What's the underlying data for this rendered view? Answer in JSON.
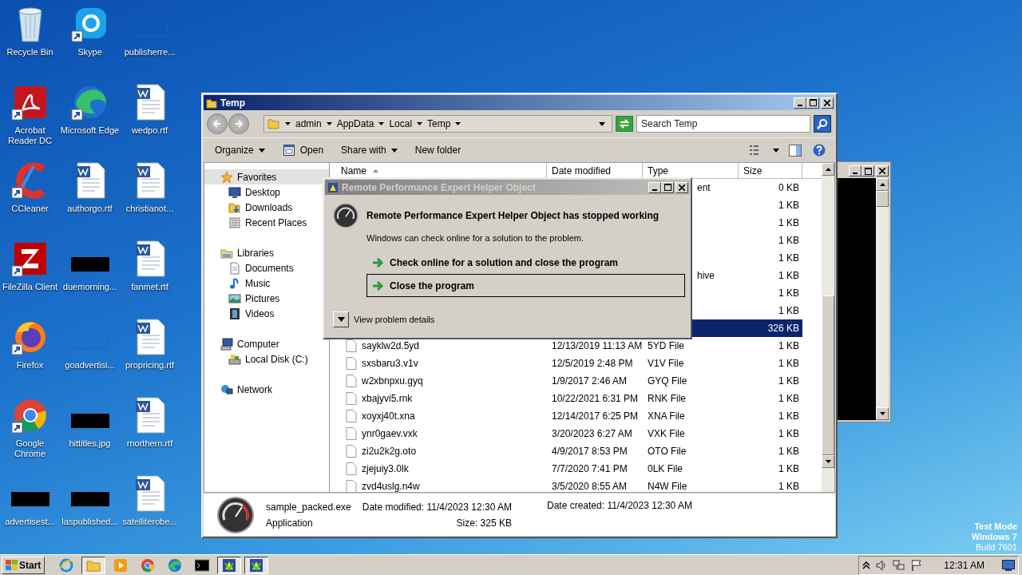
{
  "desktop_icons": [
    {
      "label": "Recycle Bin",
      "kind": "recycle-bin",
      "shortcut": false
    },
    {
      "label": "Acrobat Reader DC",
      "kind": "acrobat",
      "shortcut": true
    },
    {
      "label": "CCleaner",
      "kind": "ccleaner",
      "shortcut": true
    },
    {
      "label": "FileZilla Client",
      "kind": "filezilla",
      "shortcut": true
    },
    {
      "label": "Firefox",
      "kind": "firefox",
      "shortcut": true
    },
    {
      "label": "Google Chrome",
      "kind": "chrome",
      "shortcut": true
    },
    {
      "label": "advertisest...",
      "kind": "redacted",
      "shortcut": false
    },
    {
      "label": "Skype",
      "kind": "skype",
      "shortcut": true
    },
    {
      "label": "Microsoft Edge",
      "kind": "edge",
      "shortcut": true
    },
    {
      "label": "authorgo.rtf",
      "kind": "document",
      "shortcut": false
    },
    {
      "label": "duemorning...",
      "kind": "redacted",
      "shortcut": false
    },
    {
      "label": "goadvertisi...",
      "kind": "blank",
      "shortcut": false
    },
    {
      "label": "hittitles.jpg",
      "kind": "redacted",
      "shortcut": false
    },
    {
      "label": "laspublished...",
      "kind": "redacted",
      "shortcut": false
    },
    {
      "label": "publisherre...",
      "kind": "blank",
      "shortcut": false
    },
    {
      "label": "wedpo.rtf",
      "kind": "document",
      "shortcut": false
    },
    {
      "label": "christianot...",
      "kind": "document",
      "shortcut": false
    },
    {
      "label": "fanmet.rtf",
      "kind": "document",
      "shortcut": false
    },
    {
      "label": "propricing.rtf",
      "kind": "document",
      "shortcut": false
    },
    {
      "label": "rnorthern.rtf",
      "kind": "document",
      "shortcut": false
    },
    {
      "label": "satelliterobe...",
      "kind": "document",
      "shortcut": false
    }
  ],
  "explorer": {
    "title": "Temp",
    "breadcrumb": [
      "admin",
      "AppData",
      "Local",
      "Temp"
    ],
    "search": {
      "placeholder": "Search Temp"
    },
    "toolbar": [
      {
        "label": "Organize",
        "kind": "menu"
      },
      {
        "label": "Open",
        "kind": "open"
      },
      {
        "label": "Share with",
        "kind": "menu"
      },
      {
        "label": "New folder",
        "kind": "plain"
      }
    ],
    "nav": [
      {
        "label": "Favorites",
        "kind": "star",
        "selected": true,
        "children": [
          {
            "label": "Desktop",
            "kind": "desktop",
            "selected": false
          },
          {
            "label": "Downloads",
            "kind": "downloads",
            "selected": false
          },
          {
            "label": "Recent Places",
            "kind": "recent",
            "selected": false
          }
        ]
      },
      {
        "label": "Libraries",
        "kind": "library",
        "selected": false,
        "children": [
          {
            "label": "Documents",
            "kind": "documents",
            "selected": false
          },
          {
            "label": "Music",
            "kind": "music",
            "selected": false
          },
          {
            "label": "Pictures",
            "kind": "pictures",
            "selected": false
          },
          {
            "label": "Videos",
            "kind": "videos",
            "selected": false
          }
        ]
      },
      {
        "label": "Computer",
        "kind": "computer",
        "selected": false,
        "children": [
          {
            "label": "Local Disk (C:)",
            "kind": "disk",
            "selected": false
          }
        ]
      },
      {
        "label": "Network",
        "kind": "network",
        "selected": false
      }
    ],
    "columns": [
      "Name",
      "Date modified",
      "Type",
      "Size"
    ],
    "rows": [
      {
        "type_partial": "ent",
        "size": "0 KB",
        "selected": false
      },
      {
        "size": "1 KB",
        "selected": false
      },
      {
        "size": "1 KB",
        "selected": false
      },
      {
        "size": "1 KB",
        "selected": false
      },
      {
        "size": "1 KB",
        "selected": false
      },
      {
        "type_partial": "hive",
        "size": "1 KB",
        "selected": false
      },
      {
        "size": "1 KB",
        "selected": false
      },
      {
        "size": "1 KB",
        "selected": false
      },
      {
        "size": "326 KB",
        "selected": true
      },
      {
        "name": "sayklw2d.5yd",
        "date": "12/13/2019 11:13 AM",
        "type": "5YD File",
        "size": "1 KB",
        "selected": false
      },
      {
        "name": "sxsbaru3.v1v",
        "date": "12/5/2019 2:48 PM",
        "type": "V1V File",
        "size": "1 KB",
        "selected": false
      },
      {
        "name": "w2xbnpxu.gyq",
        "date": "1/9/2017 2:46 AM",
        "type": "GYQ File",
        "size": "1 KB",
        "selected": false
      },
      {
        "name": "xbajyvi5.rnk",
        "date": "10/22/2021 6:31 PM",
        "type": "RNK File",
        "size": "1 KB",
        "selected": false
      },
      {
        "name": "xoyxj40t.xna",
        "date": "12/14/2017 6:25 PM",
        "type": "XNA File",
        "size": "1 KB",
        "selected": false
      },
      {
        "name": "ynr0gaev.vxk",
        "date": "3/20/2023 6:27 AM",
        "type": "VXK File",
        "size": "1 KB",
        "selected": false
      },
      {
        "name": "zi2u2k2g.oto",
        "date": "4/9/2017 8:53 PM",
        "type": "OTO File",
        "size": "1 KB",
        "selected": false
      },
      {
        "name": "zjejuiy3.0lk",
        "date": "7/7/2020 7:41 PM",
        "type": "0LK File",
        "size": "1 KB",
        "selected": false
      },
      {
        "name": "zvd4uslg.n4w",
        "date": "3/5/2020 8:55 AM",
        "type": "N4W File",
        "size": "1 KB",
        "selected": false
      }
    ],
    "details": {
      "name": "sample_packed.exe",
      "type": "Application",
      "fields": [
        {
          "label": "Date modified:",
          "value": "11/4/2023 12:30 AM"
        },
        {
          "label": "Size:",
          "value": "325 KB"
        },
        {
          "label": "Date created:",
          "value": "11/4/2023 12:30 AM"
        }
      ]
    }
  },
  "dialog": {
    "title": "Remote Performance Expert Helper Object",
    "heading": "Remote Performance Expert Helper Object has stopped working",
    "message": "Windows can check online for a solution to the problem.",
    "options": [
      {
        "label": "Check online for a solution and close the program",
        "selected": false
      },
      {
        "label": "Close the program",
        "selected": true
      }
    ],
    "details_toggle": "View problem details"
  },
  "watermark": [
    "Test Mode",
    "Windows 7",
    "Build 7601"
  ],
  "taskbar": {
    "start": "Start",
    "items": [
      {
        "kind": "ie",
        "active": false
      },
      {
        "kind": "folder",
        "active": true
      },
      {
        "kind": "media",
        "active": false
      },
      {
        "kind": "chrome",
        "active": false
      },
      {
        "kind": "edge",
        "active": false
      },
      {
        "kind": "console",
        "active": false
      },
      {
        "kind": "app",
        "active": true
      },
      {
        "kind": "app",
        "active": true
      }
    ],
    "time": "12:31 AM"
  }
}
